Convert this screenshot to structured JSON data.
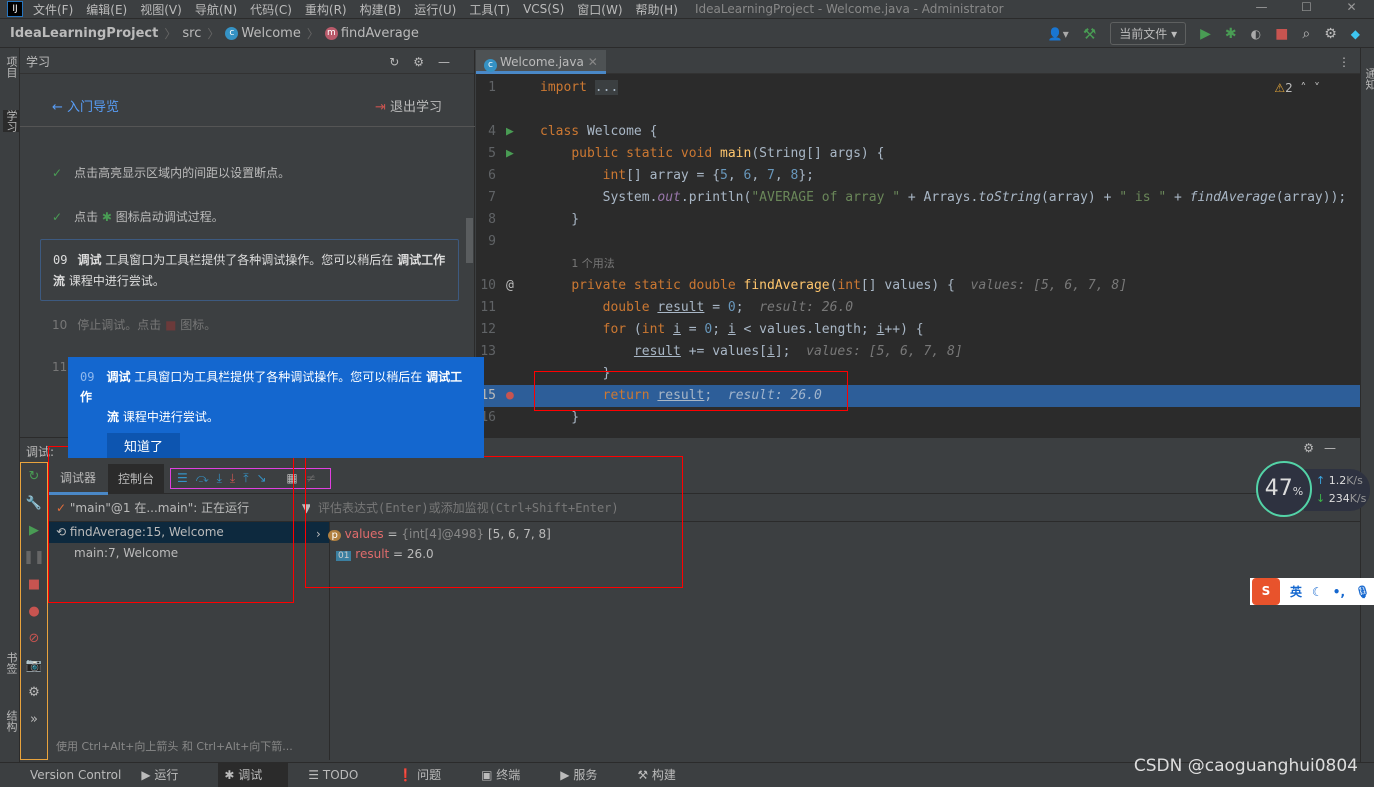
{
  "window": {
    "title": "IdeaLearningProject - Welcome.java - Administrator",
    "logo": "IJ"
  },
  "menu": [
    "文件(F)",
    "编辑(E)",
    "视图(V)",
    "导航(N)",
    "代码(C)",
    "重构(R)",
    "构建(B)",
    "运行(U)",
    "工具(T)",
    "VCS(S)",
    "窗口(W)",
    "帮助(H)"
  ],
  "breadcrumb": {
    "project": "IdeaLearningProject",
    "src": "src",
    "class": "Welcome",
    "method": "findAverage"
  },
  "toolbar": {
    "run_config": "当前文件"
  },
  "left_strip": {
    "project": "项目",
    "learn": "学习",
    "bookmarks": "书签",
    "structure": "结构"
  },
  "right_strip": {
    "notifications": "通知"
  },
  "learn": {
    "title": "学习",
    "back": "入门导览",
    "exit": "退出学习",
    "steps": [
      {
        "text": "点击高亮显示区域内的间距以设置断点。"
      },
      {
        "text_a": "点击",
        "text_b": "图标启动调试过程。"
      }
    ],
    "current": {
      "num": "09",
      "bold1": "调试",
      "text1": " 工具窗口为工具栏提供了各种调试操作。您可以稍后在 ",
      "bold2": "调试工作流",
      "text2": " 课程中进行尝试。"
    },
    "next": {
      "num": "10",
      "text_a": "停止调试。点击",
      "text_b": "图标。"
    },
    "next2": {
      "num": "11"
    },
    "popup": {
      "num": "09",
      "bold1": "调试",
      "text1": " 工具窗口为工具栏提供了各种调试操作。您可以稍后在 ",
      "bold2": "调试工作",
      "bold3": "流",
      "text2": " 课程中进行尝试。",
      "button": "知道了"
    }
  },
  "editor": {
    "tab": "Welcome.java",
    "warnings": "2",
    "usages": "1 个用法"
  },
  "debug": {
    "title": "调试:",
    "tab_debugger": "调试器",
    "tab_console": "控制台",
    "thread": "\"main\"@1 在...main\": 正在运行",
    "frames": [
      "findAverage:15, Welcome",
      "main:7, Welcome"
    ],
    "watch_placeholder": "评估表达式(Enter)或添加监视(Ctrl+Shift+Enter)",
    "vars": [
      {
        "name": "values",
        "type": "{int[4]@498}",
        "value": "[5, 6, 7, 8]"
      },
      {
        "name": "result",
        "value": "26.0"
      }
    ],
    "hint": "使用 Ctrl+Alt+向上箭头 和 Ctrl+Alt+向下箭..."
  },
  "statusbar": [
    "Version Control",
    "运行",
    "调试",
    "TODO",
    "问题",
    "终端",
    "服务",
    "构建"
  ],
  "overlay": {
    "cpu": "47",
    "cpu_unit": "%",
    "up": "1.2",
    "down": "234",
    "rate_unit": "K/s",
    "ime": "英"
  },
  "watermark": "CSDN @caoguanghui0804"
}
